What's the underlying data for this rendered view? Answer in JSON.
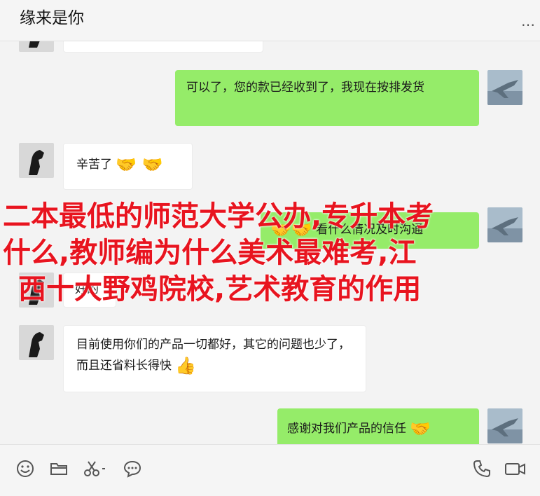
{
  "header": {
    "title": "缘来是你",
    "more_icon": "more-dots-icon",
    "more_label": "…"
  },
  "messages": [
    {
      "side": "in",
      "text": ""
    },
    {
      "side": "out",
      "text": "可以了，您的款已经收到了，我现在按排发货"
    },
    {
      "side": "in",
      "text": "辛苦了",
      "emoji": "🤝 🤝"
    },
    {
      "side": "out",
      "text": "看什么情况及时沟通",
      "emoji": "🤝🤝"
    },
    {
      "side": "in",
      "text": "好的"
    },
    {
      "side": "in",
      "text": "目前使用你们的产品一切都好，其它的问题也少了，而且还省料长得快",
      "emoji": "👍"
    },
    {
      "side": "out",
      "text": "感谢对我们产品的信任",
      "emoji": "🤝"
    }
  ],
  "overlay": {
    "lines": [
      "二本最低的师范大学公办,专升本考",
      "什么,教师编为什么美术最难考,江",
      "西十大野鸡院校,艺术教育的作用"
    ],
    "color": "#e8141f"
  },
  "footer": {
    "icons": [
      "emoji-icon",
      "folder-icon",
      "scissors-icon",
      "chat-bubble-icon",
      "phone-icon",
      "video-icon"
    ]
  },
  "colors": {
    "outgoing_bubble": "#95ec69",
    "incoming_bubble": "#ffffff",
    "background": "#f3f3f3"
  }
}
